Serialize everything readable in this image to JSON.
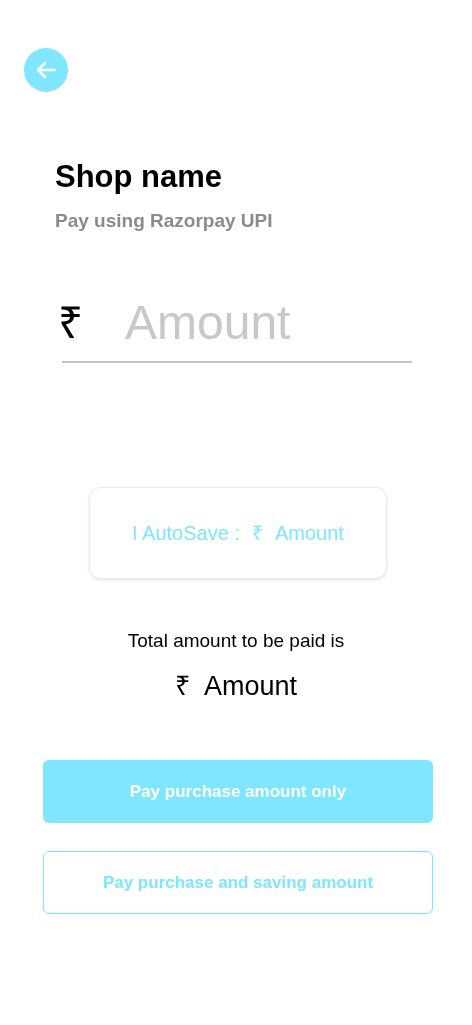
{
  "title": "Shop name",
  "subtitle": "Pay using Razorpay UPI",
  "amount_field": {
    "currency": "₹",
    "placeholder": "Amount"
  },
  "autosave": {
    "label": "I AutoSave :",
    "currency": "₹",
    "value": "Amount"
  },
  "total": {
    "label": "Total amount to be paid is",
    "currency": "₹",
    "value": "Amount"
  },
  "buttons": [
    {
      "label": "Pay purchase amount only",
      "kind": "filled"
    },
    {
      "label": "Pay purchase and saving amount",
      "kind": "outline"
    }
  ]
}
